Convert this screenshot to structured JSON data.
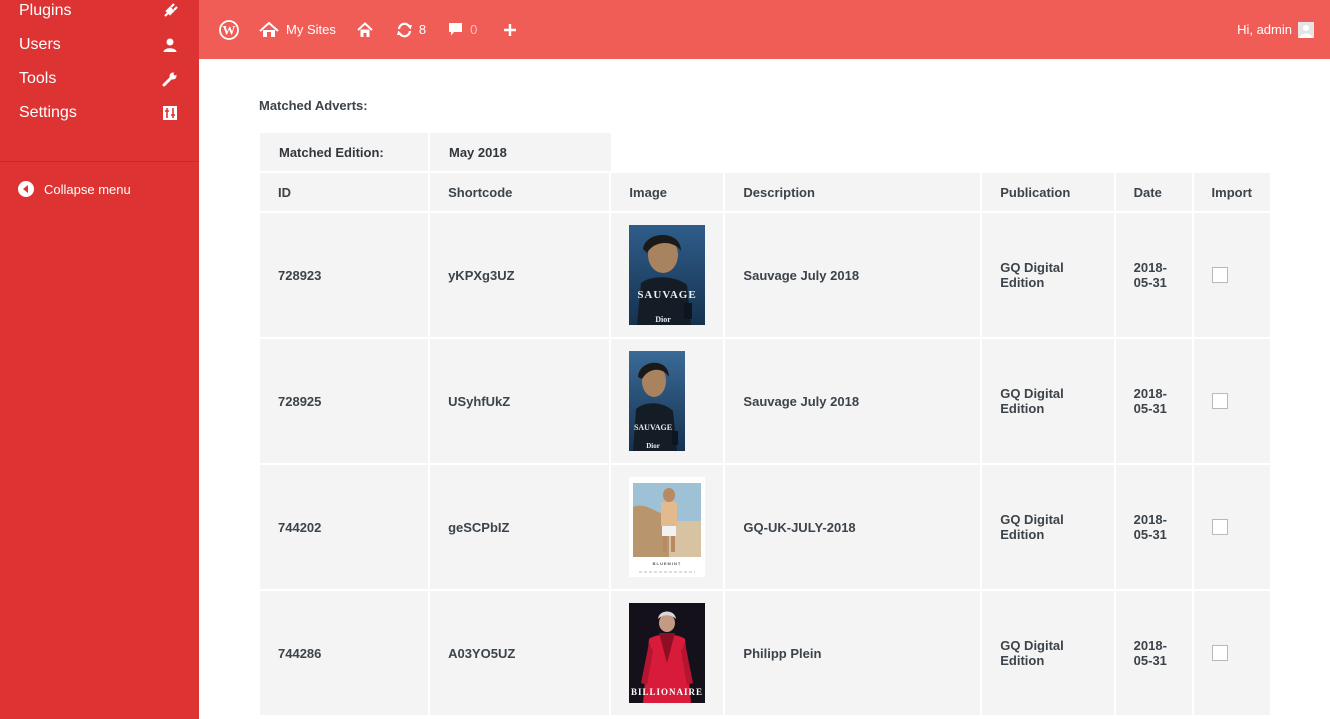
{
  "sidebar": {
    "items": [
      {
        "label": "Plugins",
        "icon": "plug-icon"
      },
      {
        "label": "Users",
        "icon": "user-icon"
      },
      {
        "label": "Tools",
        "icon": "wrench-icon"
      },
      {
        "label": "Settings",
        "icon": "settings-icon"
      }
    ],
    "collapse_label": "Collapse menu"
  },
  "topbar": {
    "my_sites": "My Sites",
    "updates_count": "8",
    "comments_count": "0",
    "greeting": "Hi, admin"
  },
  "content": {
    "matched_adverts_label": "Matched Adverts:",
    "matched_edition_label": "Matched Edition:",
    "matched_edition_value": "May 2018",
    "columns": [
      "ID",
      "Shortcode",
      "Image",
      "Description",
      "Publication",
      "Date",
      "Import"
    ],
    "rows": [
      {
        "id": "728923",
        "shortcode": "yKPXg3UZ",
        "description": "Sauvage July 2018",
        "publication": "GQ Digital Edition",
        "date": "2018-05-31",
        "image": "sauvage-ad"
      },
      {
        "id": "728925",
        "shortcode": "USyhfUkZ",
        "description": "Sauvage July 2018",
        "publication": "GQ Digital Edition",
        "date": "2018-05-31",
        "image": "sauvage-ad"
      },
      {
        "id": "744202",
        "shortcode": "geSCPbIZ",
        "description": "GQ-UK-JULY-2018",
        "publication": "GQ Digital Edition",
        "date": "2018-05-31",
        "image": "beach-ad"
      },
      {
        "id": "744286",
        "shortcode": "A03YO5UZ",
        "description": "Philipp Plein",
        "publication": "GQ Digital Edition",
        "date": "2018-05-31",
        "image": "billionaire-ad"
      }
    ]
  },
  "colors": {
    "sidebar": "#dd3333",
    "topbar": "#f05d57",
    "cell_bg": "#f4f4f4"
  }
}
